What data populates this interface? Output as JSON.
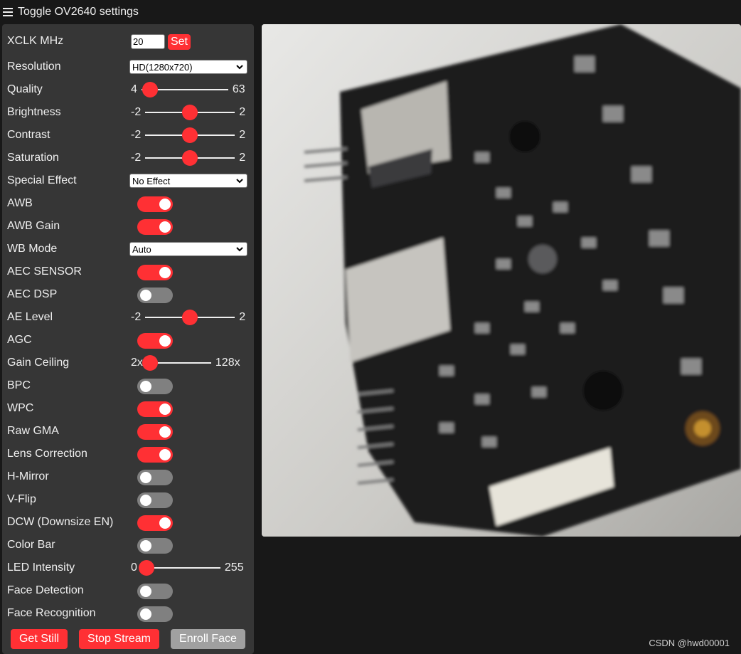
{
  "header": {
    "toggle_label": "Toggle OV2640 settings"
  },
  "settings": {
    "xclk": {
      "label": "XCLK MHz",
      "value": "20",
      "set_label": "Set"
    },
    "resolution": {
      "label": "Resolution",
      "selected": "HD(1280x720)"
    },
    "quality": {
      "label": "Quality",
      "min": "4",
      "max": "63",
      "value": 10
    },
    "brightness": {
      "label": "Brightness",
      "min": "-2",
      "max": "2",
      "value": 0
    },
    "contrast": {
      "label": "Contrast",
      "min": "-2",
      "max": "2",
      "value": 0
    },
    "saturation": {
      "label": "Saturation",
      "min": "-2",
      "max": "2",
      "value": 0
    },
    "special_effect": {
      "label": "Special Effect",
      "selected": "No Effect"
    },
    "awb": {
      "label": "AWB",
      "on": true
    },
    "awb_gain": {
      "label": "AWB Gain",
      "on": true
    },
    "wb_mode": {
      "label": "WB Mode",
      "selected": "Auto"
    },
    "aec_sensor": {
      "label": "AEC SENSOR",
      "on": true
    },
    "aec_dsp": {
      "label": "AEC DSP",
      "on": false
    },
    "ae_level": {
      "label": "AE Level",
      "min": "-2",
      "max": "2",
      "value": 0
    },
    "agc": {
      "label": "AGC",
      "on": true
    },
    "gain_ceiling": {
      "label": "Gain Ceiling",
      "min": "2x",
      "max": "128x",
      "value": 0
    },
    "bpc": {
      "label": "BPC",
      "on": false
    },
    "wpc": {
      "label": "WPC",
      "on": true
    },
    "raw_gma": {
      "label": "Raw GMA",
      "on": true
    },
    "lens_correction": {
      "label": "Lens Correction",
      "on": true
    },
    "h_mirror": {
      "label": "H-Mirror",
      "on": false
    },
    "v_flip": {
      "label": "V-Flip",
      "on": false
    },
    "dcw": {
      "label": "DCW (Downsize EN)",
      "on": true
    },
    "color_bar": {
      "label": "Color Bar",
      "on": false
    },
    "led_intensity": {
      "label": "LED Intensity",
      "min": "0",
      "max": "255",
      "value": 0
    },
    "face_detection": {
      "label": "Face Detection",
      "on": false
    },
    "face_recognition": {
      "label": "Face Recognition",
      "on": false
    }
  },
  "buttons": {
    "get_still": "Get Still",
    "stop_stream": "Stop Stream",
    "enroll_face": "Enroll Face"
  },
  "watermark": "CSDN @hwd00001",
  "colors": {
    "accent": "#ff3034",
    "panel": "#363636",
    "background": "#181818",
    "toggle_off": "#808080",
    "button_disabled": "#a0a0a0"
  }
}
